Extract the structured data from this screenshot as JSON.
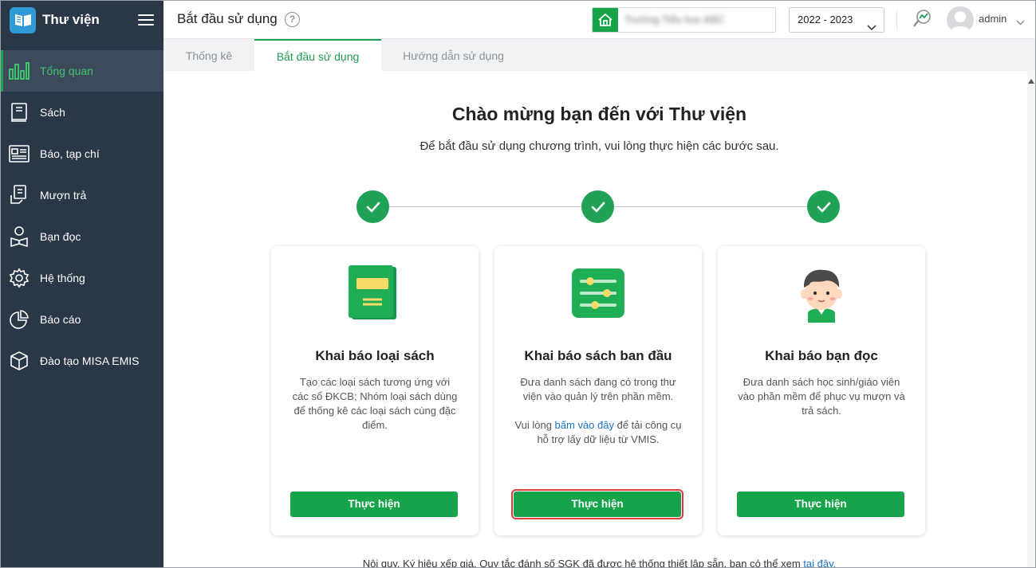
{
  "app": {
    "title": "Thư viện"
  },
  "sidebar": {
    "items": [
      {
        "label": "Tổng quan",
        "icon": "chart-bars-icon",
        "active": true
      },
      {
        "label": "Sách",
        "icon": "book-icon"
      },
      {
        "label": "Báo, tạp chí",
        "icon": "newspaper-icon"
      },
      {
        "label": "Mượn trả",
        "icon": "borrow-return-icon"
      },
      {
        "label": "Bạn đọc",
        "icon": "reader-icon"
      },
      {
        "label": "Hệ thống",
        "icon": "gear-icon"
      },
      {
        "label": "Báo cáo",
        "icon": "pie-chart-icon"
      },
      {
        "label": "Đào tạo MISA EMIS",
        "icon": "cube-icon"
      }
    ]
  },
  "header": {
    "page_title": "Bắt đầu sử dụng",
    "help": "?",
    "school_name": "Trường Tiểu học ABC",
    "school_year": "2022 - 2023",
    "user": "admin"
  },
  "tabs": [
    {
      "label": "Thống kê"
    },
    {
      "label": "Bắt đầu sử dụng",
      "active": true
    },
    {
      "label": "Hướng dẫn sử dụng"
    }
  ],
  "main": {
    "welcome_title": "Chào mừng bạn đến với Thư viện",
    "welcome_sub": "Để bắt đầu sử dụng chương trình, vui lòng thực hiện các bước sau.",
    "steps_completed": 3,
    "cards": [
      {
        "title": "Khai báo loại sách",
        "desc": "Tạo các loại sách tương ứng với các sổ ĐKCB; Nhóm loại sách dùng để thống kê các loại sách cùng đặc điểm.",
        "button": "Thực hiện",
        "icon": "green-book-icon"
      },
      {
        "title": "Khai báo sách ban đầu",
        "desc": "Đưa danh sách đang có trong thư viện vào quản lý trên phần mềm.",
        "desc2_pre": "Vui lòng ",
        "desc2_link": "bấm vào đây",
        "desc2_post": " để tải công cụ hỗ trợ lấy dữ liệu từ VMIS.",
        "button": "Thực hiện",
        "icon": "sliders-icon",
        "highlighted": true
      },
      {
        "title": "Khai báo bạn đọc",
        "desc": "Đưa danh sách học sinh/giáo viên vào phần mềm để phục vụ mượn và trả sách.",
        "button": "Thực hiện",
        "icon": "student-avatar-icon"
      }
    ],
    "footnote_pre": "Nội quy, Ký hiệu xếp giá, Quy tắc đánh số SGK đã được hệ thống thiết lập sẵn, bạn có thể xem ",
    "footnote_link": "tại đây."
  },
  "colors": {
    "sidebar_bg": "#2a3747",
    "accent_green": "#17a34a",
    "active_text": "#3ec26d",
    "highlight_red": "#e0393e"
  }
}
